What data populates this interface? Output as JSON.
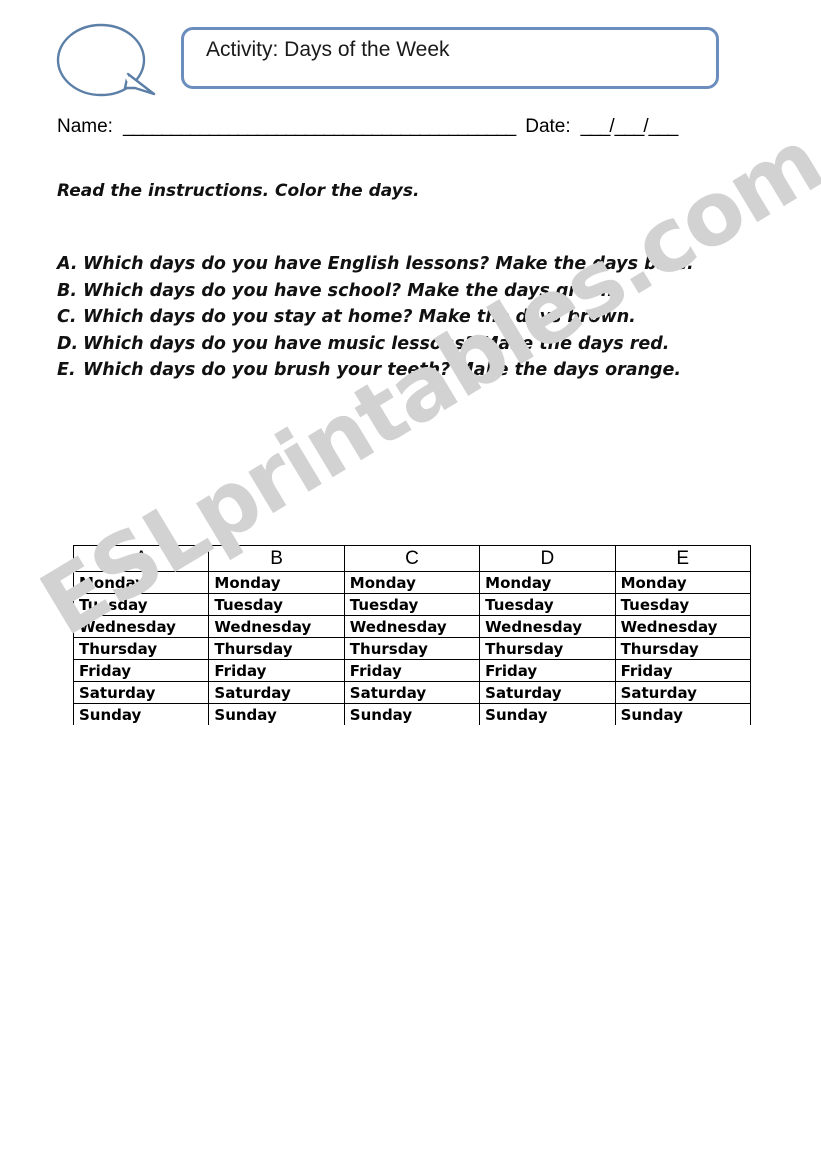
{
  "header": {
    "bubble_icon": "speech-bubble-icon",
    "title": "Activity: Days of the Week"
  },
  "name_date": {
    "name_label": "Name:",
    "name_rule": "_________________________________________",
    "date_label": "Date:",
    "date_rule_day": "___",
    "date_sep1": "/",
    "date_rule_month": "___",
    "date_sep2": "/",
    "date_rule_year": "___"
  },
  "intro": {
    "text": "Read the instructions. Color the days."
  },
  "questions": [
    {
      "marker": "A.",
      "text": "Which days do you have English lessons? Make the days blue.",
      "justified": true
    },
    {
      "marker": "B.",
      "text": "Which days do you have school? Make the days green.",
      "justified": false
    },
    {
      "marker": "C.",
      "text": "Which days do you stay at home? Make the days brown.",
      "justified": false
    },
    {
      "marker": "D.",
      "text": "Which days do you have music lessons? Make the days red.",
      "justified": false
    },
    {
      "marker": "E.",
      "text": "Which days do you brush your teeth? Make the days orange.",
      "justified": true
    }
  ],
  "table": {
    "headers": [
      "A",
      "B",
      "C",
      "D",
      "E"
    ],
    "rows": [
      [
        "Monday",
        "Monday",
        "Monday",
        "Monday",
        "Monday"
      ],
      [
        "Tuesday",
        "Tuesday",
        "Tuesday",
        "Tuesday",
        "Tuesday"
      ],
      [
        "Wednesday",
        "Wednesday",
        "Wednesday",
        "Wednesday",
        "Wednesday"
      ],
      [
        "Thursday",
        "Thursday",
        "Thursday",
        "Thursday",
        "Thursday"
      ],
      [
        "Friday",
        "Friday",
        "Friday",
        "Friday",
        "Friday"
      ],
      [
        "Saturday",
        "Saturday",
        "Saturday",
        "Saturday",
        "Saturday"
      ],
      [
        "Sunday",
        "Sunday",
        "Sunday",
        "Sunday",
        "Sunday"
      ]
    ]
  },
  "watermark": {
    "text": "ESLprintables.com",
    "color": "#d2d2d2"
  },
  "colors": {
    "accent_blue": "#6c8ebf",
    "ink": "#000000",
    "page": "#ffffff"
  }
}
